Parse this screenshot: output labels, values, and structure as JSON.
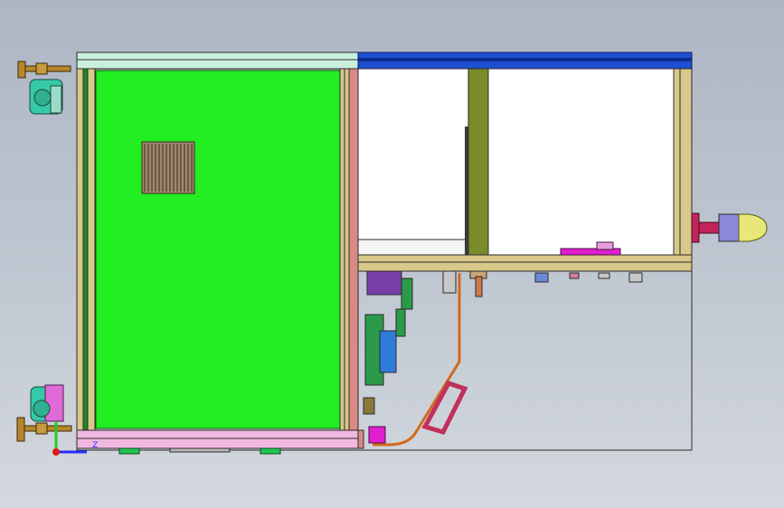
{
  "viewport": {
    "background_top": "#aeb6c4",
    "background_bottom": "#d4d8de"
  },
  "model": {
    "colors": {
      "frame_outline": "#2b2b2b",
      "top_rail_light": "#c9f0dc",
      "top_rail_blue": "#1f4fd1",
      "side_panel_green": "#22ee22",
      "vent_grille": "#a08870",
      "aluminum_profile": "#d8c88a",
      "divider_salmon": "#d98a86",
      "vertical_post_olive": "#7a8c2a",
      "cable_orange": "#d2691e",
      "handle_red": "#c0305a",
      "motor_blue": "#2e7bd8",
      "motor_green": "#2a9a4a",
      "bracket_purple": "#7a3ea8",
      "caster_teal": "#36c9a8",
      "caster_pink": "#e06ad8",
      "leveling_foot_bronze": "#b8862a",
      "beacon_yellow": "#e8e87a",
      "beacon_red": "#c0245a",
      "magenta_plate": "#e020d0",
      "base_pink": "#f0b8e0",
      "foot_green": "#22c455"
    },
    "parts": [
      "leveling-foot-top",
      "caster-top",
      "leveling-foot-bottom",
      "caster-bottom",
      "top-rail",
      "side-panel",
      "vent-grille",
      "divider-post",
      "vertical-post",
      "crossbar",
      "cable-loop",
      "handle",
      "motor-assembly",
      "beacon-light",
      "base-rail"
    ]
  },
  "triad": {
    "x_axis_color": "#2a2aff",
    "y_axis_color": "#22cc22",
    "z_label": "Z"
  }
}
